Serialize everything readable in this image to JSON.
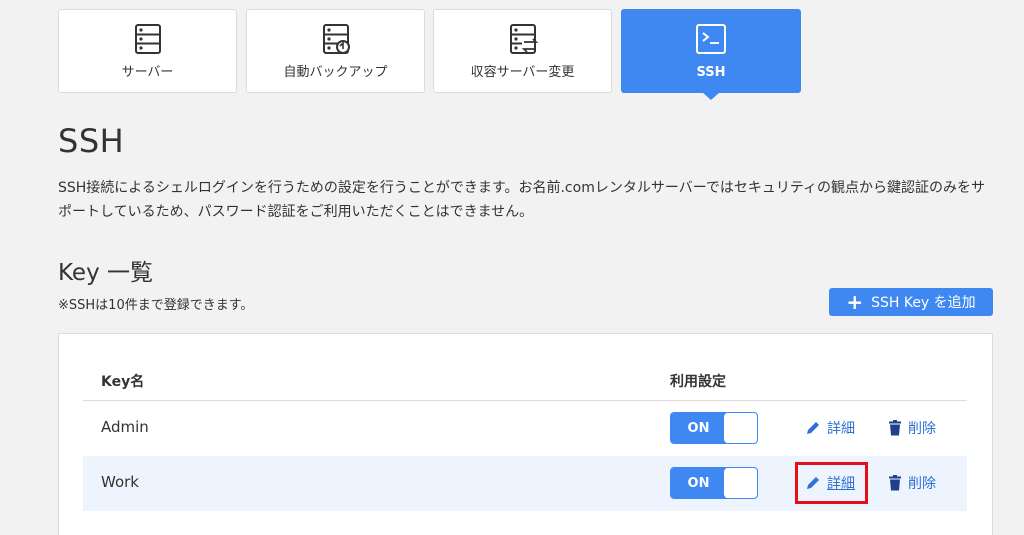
{
  "tabs": [
    {
      "label": "サーバー",
      "icon": "server-icon",
      "active": false
    },
    {
      "label": "自動バックアップ",
      "icon": "server-backup-icon",
      "active": false
    },
    {
      "label": "収容サーバー変更",
      "icon": "server-transfer-icon",
      "active": false
    },
    {
      "label": "SSH",
      "icon": "terminal-icon",
      "active": true
    }
  ],
  "page": {
    "title": "SSH",
    "description": "SSH接続によるシェルログインを行うための設定を行うことができます。お名前.comレンタルサーバーではセキュリティの観点から鍵認証のみをサポートしているため、パスワード認証をご利用いただくことはできません。"
  },
  "key_list": {
    "title": "Key 一覧",
    "note": "※SSHは10件まで登録できます。",
    "add_button": "SSH Key を追加",
    "columns": {
      "name": "Key名",
      "setting": "利用設定"
    },
    "rows": [
      {
        "name": "Admin",
        "toggle": "ON",
        "edit": "詳細",
        "delete": "削除"
      },
      {
        "name": "Work",
        "toggle": "ON",
        "edit": "詳細",
        "delete": "削除"
      }
    ]
  },
  "colors": {
    "accent": "#3f88f2",
    "link": "#2f6fd6",
    "highlight_row": "#eef4fd",
    "callout": "#e3101a"
  }
}
